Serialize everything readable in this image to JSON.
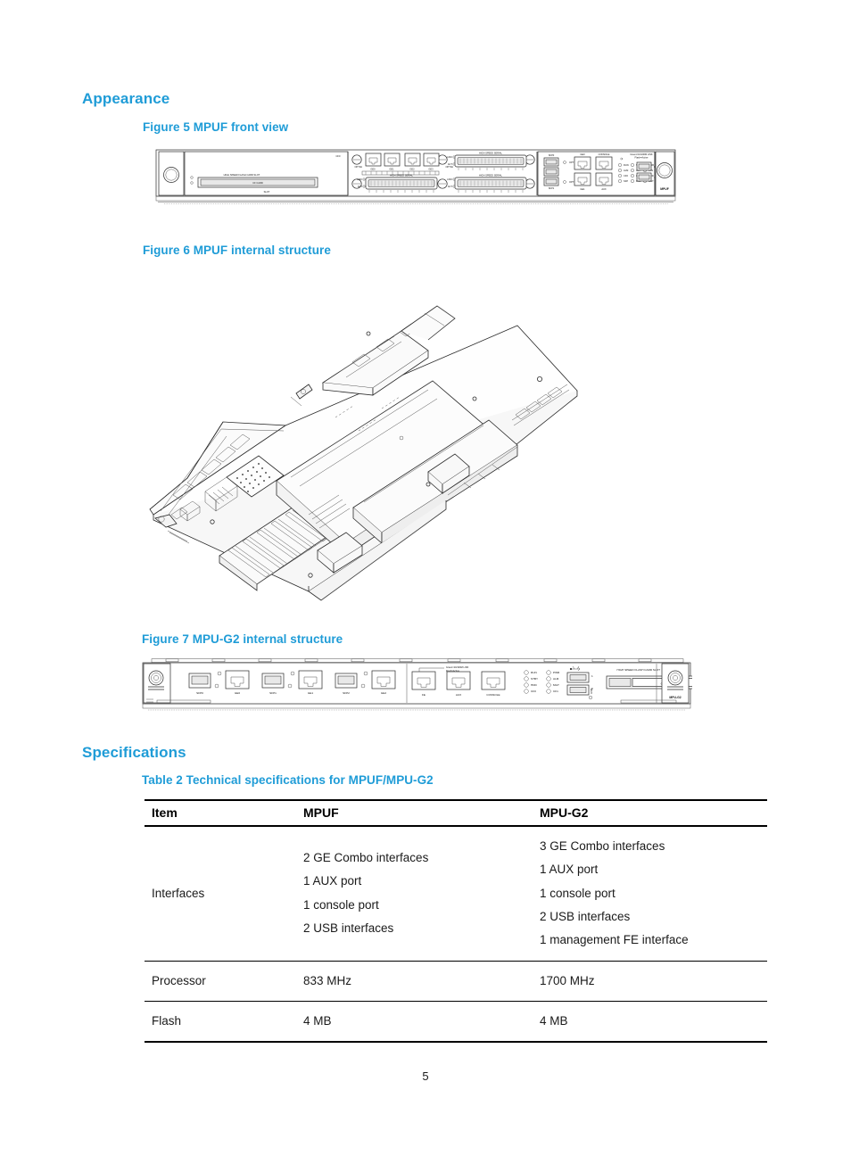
{
  "document": {
    "page_number": "5"
  },
  "sections": [
    {
      "id": "appearance",
      "heading": "Appearance"
    },
    {
      "id": "specifications",
      "heading": "Specifications"
    }
  ],
  "figures": [
    {
      "id": "figure-5",
      "caption": "Figure 5 MPUF front view",
      "board_label": "MPUF",
      "port_labels": [
        "GE0",
        "GE1",
        "GE2",
        "GE3",
        "FE",
        "AUX",
        "CONSOLE",
        "USB",
        "LINK",
        "ACT",
        "SFP"
      ]
    },
    {
      "id": "figure-6",
      "caption": "Figure 6 MPUF internal structure"
    },
    {
      "id": "figure-7",
      "caption": "Figure 7 MPU-G2 internal structure",
      "board_label": "MPU-G2",
      "port_labels": [
        "SFP0",
        "GE0",
        "SFP1",
        "GE1",
        "SFP2",
        "GE2",
        "FE",
        "AUX",
        "CONSOLE"
      ],
      "led_labels": [
        "RUN",
        "PWR",
        "ALM",
        "STBY",
        "SFP"
      ],
      "note": "Green=10/100M LINK\nFlash=Active"
    }
  ],
  "table": {
    "caption": "Table 2 Technical specifications for MPUF/MPU-G2",
    "headers": [
      "Item",
      "MPUF",
      "MPU-G2"
    ],
    "rows": [
      {
        "item": "Interfaces",
        "mpuf": [
          "2 GE Combo interfaces",
          "1 AUX port",
          "1 console port",
          "2 USB interfaces"
        ],
        "mpug2": [
          "3 GE Combo interfaces",
          "1 AUX port",
          "1 console port",
          "2 USB interfaces",
          "1 management FE interface"
        ]
      },
      {
        "item": "Processor",
        "mpuf": [
          "833 MHz"
        ],
        "mpug2": [
          "1700 MHz"
        ]
      },
      {
        "item": "Flash",
        "mpuf": [
          "4 MB"
        ],
        "mpug2": [
          "4 MB"
        ]
      }
    ]
  },
  "colors": {
    "heading": "#1f9cd7",
    "text": "#1a1a1a",
    "rule": "#000000"
  }
}
